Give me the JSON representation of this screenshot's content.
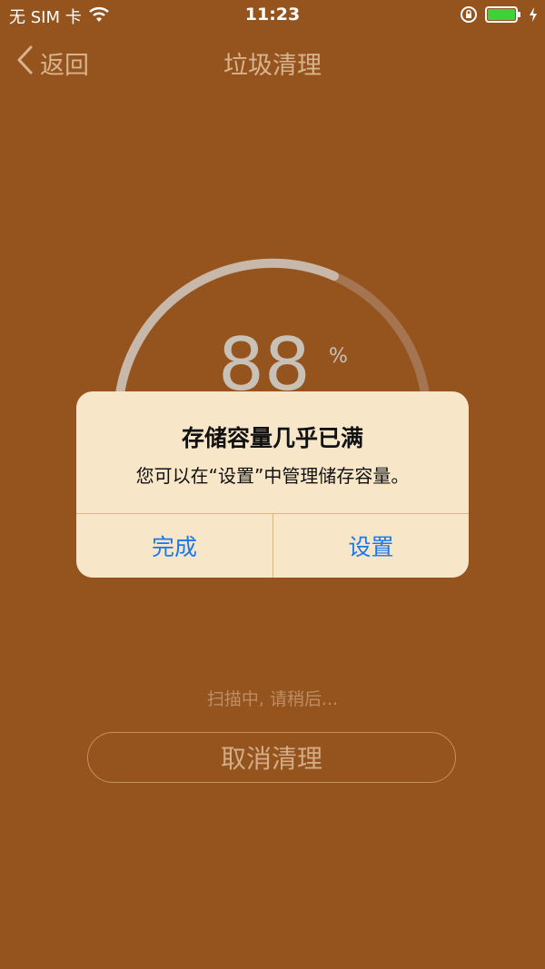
{
  "status_bar": {
    "carrier": "无 SIM 卡",
    "time": "11:23"
  },
  "nav": {
    "back_label": "返回",
    "title": "垃圾清理"
  },
  "gauge": {
    "value": "88",
    "unit": "%"
  },
  "scan_status": "扫描中, 请稍后...",
  "cancel_button_label": "取消清理",
  "alert": {
    "title": "存储容量几乎已满",
    "message": "您可以在“设置”中管理储存容量。",
    "done_label": "完成",
    "settings_label": "设置"
  },
  "colors": {
    "background": "#95541e",
    "alert_background": "#f8e6c8",
    "alert_button": "#1778f2",
    "battery": "#3ad33a"
  }
}
